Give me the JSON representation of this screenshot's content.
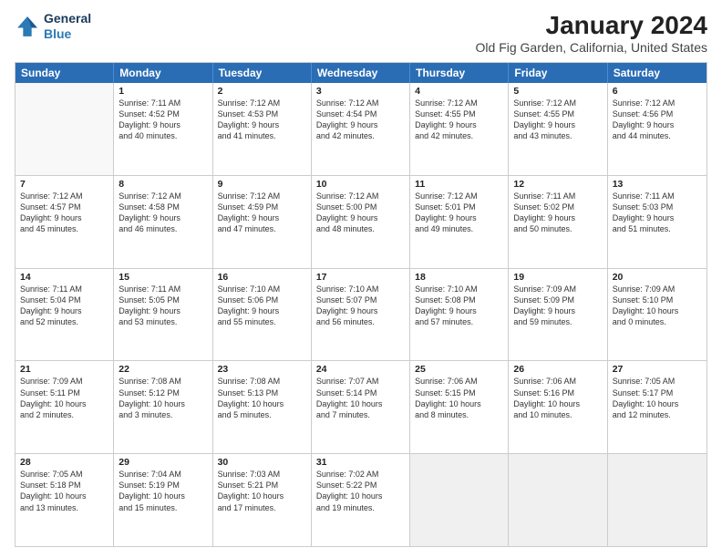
{
  "header": {
    "logo_line1": "General",
    "logo_line2": "Blue",
    "month_year": "January 2024",
    "location": "Old Fig Garden, California, United States"
  },
  "weekdays": [
    "Sunday",
    "Monday",
    "Tuesday",
    "Wednesday",
    "Thursday",
    "Friday",
    "Saturday"
  ],
  "weeks": [
    [
      {
        "day": "",
        "lines": []
      },
      {
        "day": "1",
        "lines": [
          "Sunrise: 7:11 AM",
          "Sunset: 4:52 PM",
          "Daylight: 9 hours",
          "and 40 minutes."
        ]
      },
      {
        "day": "2",
        "lines": [
          "Sunrise: 7:12 AM",
          "Sunset: 4:53 PM",
          "Daylight: 9 hours",
          "and 41 minutes."
        ]
      },
      {
        "day": "3",
        "lines": [
          "Sunrise: 7:12 AM",
          "Sunset: 4:54 PM",
          "Daylight: 9 hours",
          "and 42 minutes."
        ]
      },
      {
        "day": "4",
        "lines": [
          "Sunrise: 7:12 AM",
          "Sunset: 4:55 PM",
          "Daylight: 9 hours",
          "and 42 minutes."
        ]
      },
      {
        "day": "5",
        "lines": [
          "Sunrise: 7:12 AM",
          "Sunset: 4:55 PM",
          "Daylight: 9 hours",
          "and 43 minutes."
        ]
      },
      {
        "day": "6",
        "lines": [
          "Sunrise: 7:12 AM",
          "Sunset: 4:56 PM",
          "Daylight: 9 hours",
          "and 44 minutes."
        ]
      }
    ],
    [
      {
        "day": "7",
        "lines": [
          "Sunrise: 7:12 AM",
          "Sunset: 4:57 PM",
          "Daylight: 9 hours",
          "and 45 minutes."
        ]
      },
      {
        "day": "8",
        "lines": [
          "Sunrise: 7:12 AM",
          "Sunset: 4:58 PM",
          "Daylight: 9 hours",
          "and 46 minutes."
        ]
      },
      {
        "day": "9",
        "lines": [
          "Sunrise: 7:12 AM",
          "Sunset: 4:59 PM",
          "Daylight: 9 hours",
          "and 47 minutes."
        ]
      },
      {
        "day": "10",
        "lines": [
          "Sunrise: 7:12 AM",
          "Sunset: 5:00 PM",
          "Daylight: 9 hours",
          "and 48 minutes."
        ]
      },
      {
        "day": "11",
        "lines": [
          "Sunrise: 7:12 AM",
          "Sunset: 5:01 PM",
          "Daylight: 9 hours",
          "and 49 minutes."
        ]
      },
      {
        "day": "12",
        "lines": [
          "Sunrise: 7:11 AM",
          "Sunset: 5:02 PM",
          "Daylight: 9 hours",
          "and 50 minutes."
        ]
      },
      {
        "day": "13",
        "lines": [
          "Sunrise: 7:11 AM",
          "Sunset: 5:03 PM",
          "Daylight: 9 hours",
          "and 51 minutes."
        ]
      }
    ],
    [
      {
        "day": "14",
        "lines": [
          "Sunrise: 7:11 AM",
          "Sunset: 5:04 PM",
          "Daylight: 9 hours",
          "and 52 minutes."
        ]
      },
      {
        "day": "15",
        "lines": [
          "Sunrise: 7:11 AM",
          "Sunset: 5:05 PM",
          "Daylight: 9 hours",
          "and 53 minutes."
        ]
      },
      {
        "day": "16",
        "lines": [
          "Sunrise: 7:10 AM",
          "Sunset: 5:06 PM",
          "Daylight: 9 hours",
          "and 55 minutes."
        ]
      },
      {
        "day": "17",
        "lines": [
          "Sunrise: 7:10 AM",
          "Sunset: 5:07 PM",
          "Daylight: 9 hours",
          "and 56 minutes."
        ]
      },
      {
        "day": "18",
        "lines": [
          "Sunrise: 7:10 AM",
          "Sunset: 5:08 PM",
          "Daylight: 9 hours",
          "and 57 minutes."
        ]
      },
      {
        "day": "19",
        "lines": [
          "Sunrise: 7:09 AM",
          "Sunset: 5:09 PM",
          "Daylight: 9 hours",
          "and 59 minutes."
        ]
      },
      {
        "day": "20",
        "lines": [
          "Sunrise: 7:09 AM",
          "Sunset: 5:10 PM",
          "Daylight: 10 hours",
          "and 0 minutes."
        ]
      }
    ],
    [
      {
        "day": "21",
        "lines": [
          "Sunrise: 7:09 AM",
          "Sunset: 5:11 PM",
          "Daylight: 10 hours",
          "and 2 minutes."
        ]
      },
      {
        "day": "22",
        "lines": [
          "Sunrise: 7:08 AM",
          "Sunset: 5:12 PM",
          "Daylight: 10 hours",
          "and 3 minutes."
        ]
      },
      {
        "day": "23",
        "lines": [
          "Sunrise: 7:08 AM",
          "Sunset: 5:13 PM",
          "Daylight: 10 hours",
          "and 5 minutes."
        ]
      },
      {
        "day": "24",
        "lines": [
          "Sunrise: 7:07 AM",
          "Sunset: 5:14 PM",
          "Daylight: 10 hours",
          "and 7 minutes."
        ]
      },
      {
        "day": "25",
        "lines": [
          "Sunrise: 7:06 AM",
          "Sunset: 5:15 PM",
          "Daylight: 10 hours",
          "and 8 minutes."
        ]
      },
      {
        "day": "26",
        "lines": [
          "Sunrise: 7:06 AM",
          "Sunset: 5:16 PM",
          "Daylight: 10 hours",
          "and 10 minutes."
        ]
      },
      {
        "day": "27",
        "lines": [
          "Sunrise: 7:05 AM",
          "Sunset: 5:17 PM",
          "Daylight: 10 hours",
          "and 12 minutes."
        ]
      }
    ],
    [
      {
        "day": "28",
        "lines": [
          "Sunrise: 7:05 AM",
          "Sunset: 5:18 PM",
          "Daylight: 10 hours",
          "and 13 minutes."
        ]
      },
      {
        "day": "29",
        "lines": [
          "Sunrise: 7:04 AM",
          "Sunset: 5:19 PM",
          "Daylight: 10 hours",
          "and 15 minutes."
        ]
      },
      {
        "day": "30",
        "lines": [
          "Sunrise: 7:03 AM",
          "Sunset: 5:21 PM",
          "Daylight: 10 hours",
          "and 17 minutes."
        ]
      },
      {
        "day": "31",
        "lines": [
          "Sunrise: 7:02 AM",
          "Sunset: 5:22 PM",
          "Daylight: 10 hours",
          "and 19 minutes."
        ]
      },
      {
        "day": "",
        "lines": []
      },
      {
        "day": "",
        "lines": []
      },
      {
        "day": "",
        "lines": []
      }
    ]
  ]
}
